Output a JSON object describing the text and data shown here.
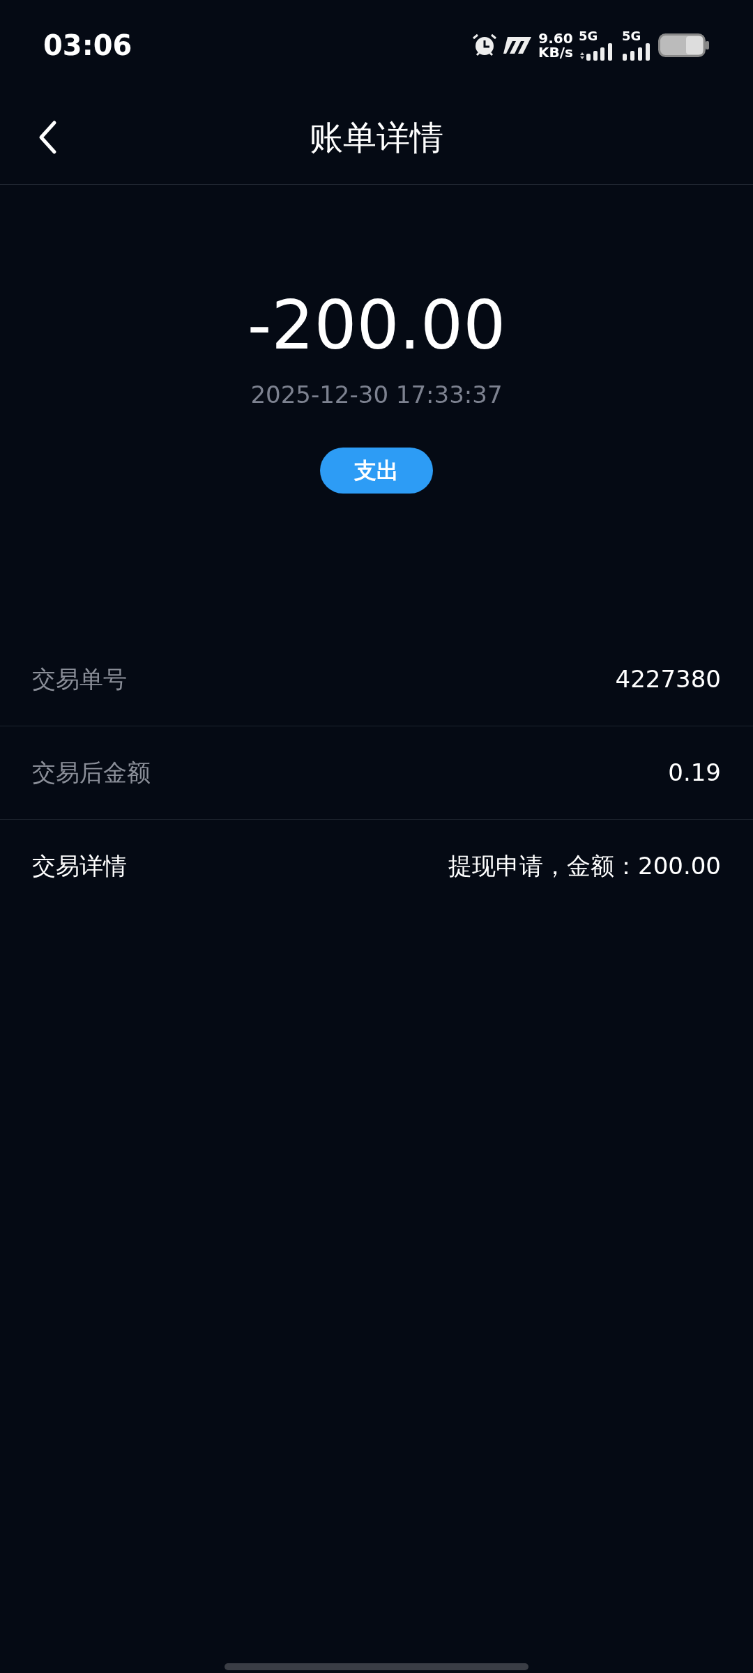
{
  "status_bar": {
    "time": "03:06",
    "speed_value": "9.60",
    "speed_unit": "KB/s",
    "network_1": "5G",
    "network_2": "5G"
  },
  "header": {
    "title": "账单详情"
  },
  "summary": {
    "amount": "-200.00",
    "datetime": "2025-12-30 17:33:37",
    "type_badge": "支出"
  },
  "rows": [
    {
      "label": "交易单号",
      "value": "4227380",
      "dimmed": true
    },
    {
      "label": "交易后金额",
      "value": "0.19",
      "dimmed": true
    },
    {
      "label": "交易详情",
      "value": "提现申请，金额：200.00",
      "dimmed": false
    }
  ]
}
